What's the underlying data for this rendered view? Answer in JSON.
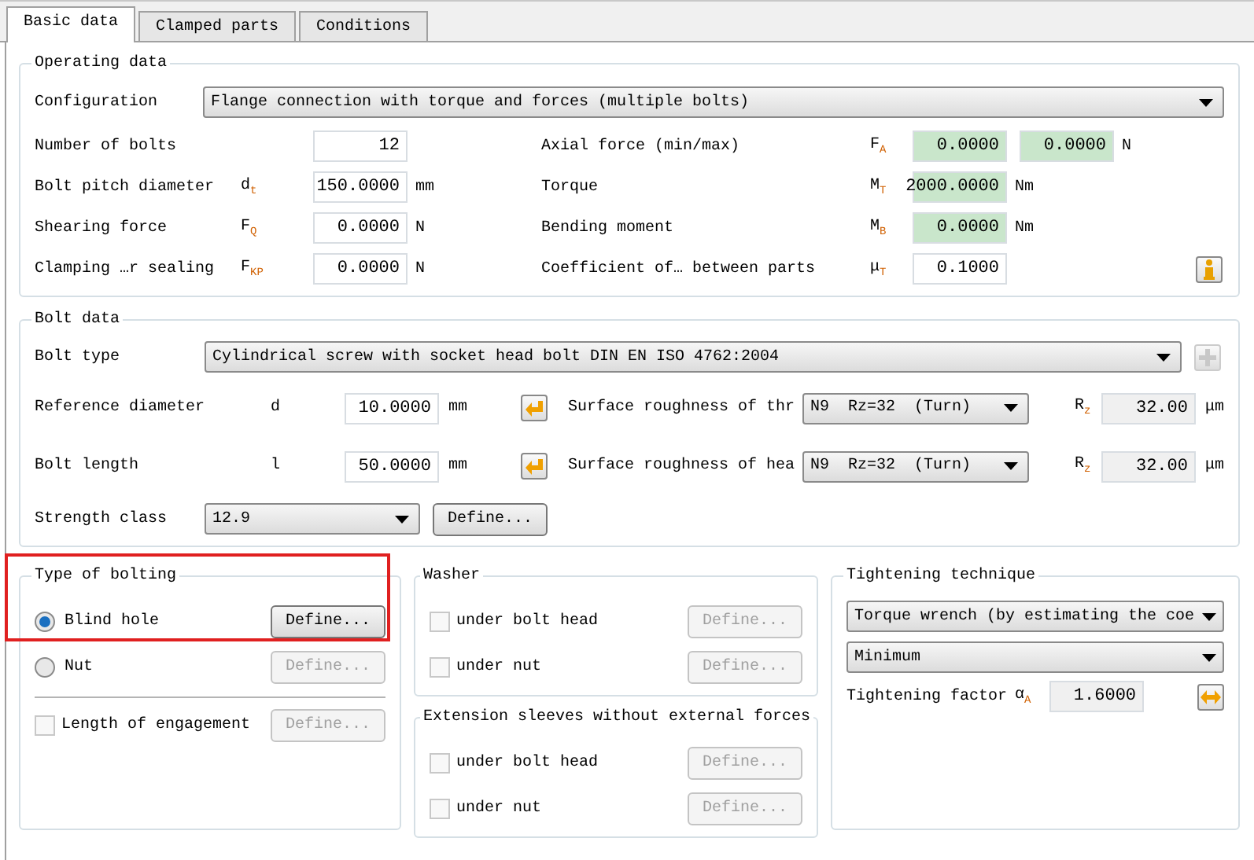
{
  "tabs": [
    {
      "label": "Basic data",
      "selected": true
    },
    {
      "label": "Clamped parts",
      "selected": false
    },
    {
      "label": "Conditions",
      "selected": false
    }
  ],
  "operating_data": {
    "title": "Operating data",
    "configuration": {
      "label": "Configuration",
      "value": "Flange connection with torque and forces (multiple bolts)"
    },
    "left_rows": [
      {
        "label": "Number of bolts",
        "value": "12"
      },
      {
        "label": "Bolt pitch diameter",
        "symbol": "d$_{t}$",
        "value": "150.0000",
        "unit": "mm"
      },
      {
        "label": "Shearing force",
        "symbol": "F$_{Q}$",
        "value": "0.0000",
        "unit": "N"
      },
      {
        "label": "Clamping …r sealing",
        "symbol": "F$_{KP}$",
        "value": "0.0000",
        "unit": "N"
      }
    ],
    "right_rows": [
      {
        "label": "Axial force (min/max)",
        "symbol": "F$_{A}$",
        "values": [
          "0.0000",
          "0.0000"
        ],
        "unit": "N",
        "highlighted": true
      },
      {
        "label": "Torque",
        "symbol": "M$_{T}$",
        "values": [
          "2000.0000"
        ],
        "unit": "Nm",
        "highlighted": true
      },
      {
        "label": "Bending moment",
        "symbol": "M$_{B}$",
        "values": [
          "0.0000"
        ],
        "unit": "Nm",
        "highlighted": true
      },
      {
        "label": "Coefficient of… between parts",
        "symbol": "μ$_{T}$",
        "values": [
          "0.1000"
        ],
        "highlighted": false,
        "info_button": true
      }
    ]
  },
  "bolt_data": {
    "title": "Bolt data",
    "bolt_type": {
      "label": "Bolt type",
      "value": "Cylindrical screw with socket head bolt DIN EN ISO 4762:2004",
      "add_disabled": true
    },
    "rows": [
      {
        "label": "Reference diameter",
        "symbol": "d",
        "value": "10.0000",
        "unit": "mm",
        "roughness_label": "Surface roughness of thr",
        "roughness_value": "N9  Rz=32  (Turn)",
        "rz_symbol": "R$_{z}$",
        "rz_value": "32.00",
        "rz_unit": "μm"
      },
      {
        "label": "Bolt length",
        "symbol": "l",
        "value": "50.0000",
        "unit": "mm",
        "roughness_label": "Surface roughness of hea",
        "roughness_value": "N9  Rz=32  (Turn)",
        "rz_symbol": "R$_{z}$",
        "rz_value": "32.00",
        "rz_unit": "μm"
      }
    ],
    "strength_class": {
      "label": "Strength class",
      "value": "12.9",
      "button": "Define..."
    }
  },
  "type_of_bolting": {
    "title": "Type of bolting",
    "highlighted": true,
    "options": [
      {
        "label": "Blind hole",
        "selected": true,
        "button": "Define...",
        "button_disabled": false
      },
      {
        "label": "Nut",
        "selected": false,
        "button": "Define...",
        "button_disabled": true
      }
    ],
    "engagement": {
      "label": "Length of engagement",
      "checked": false,
      "button": "Define...",
      "button_disabled": true
    }
  },
  "washer": {
    "title": "Washer",
    "items": [
      {
        "label": "under bolt head",
        "checked": false,
        "button": "Define...",
        "button_disabled": true
      },
      {
        "label": "under nut",
        "checked": false,
        "button": "Define...",
        "button_disabled": true
      }
    ]
  },
  "extension_sleeves": {
    "title": "Extension sleeves without external forces",
    "items": [
      {
        "label": "under bolt head",
        "checked": false,
        "button": "Define...",
        "button_disabled": true
      },
      {
        "label": "under nut",
        "checked": false,
        "button": "Define...",
        "button_disabled": true
      }
    ]
  },
  "tightening": {
    "title": "Tightening technique",
    "method": "Torque wrench (by estimating the coe",
    "level_option": "Minimum",
    "factor": {
      "label": "Tightening factor",
      "symbol": "α$_{A}$",
      "value": "1.6000"
    }
  }
}
